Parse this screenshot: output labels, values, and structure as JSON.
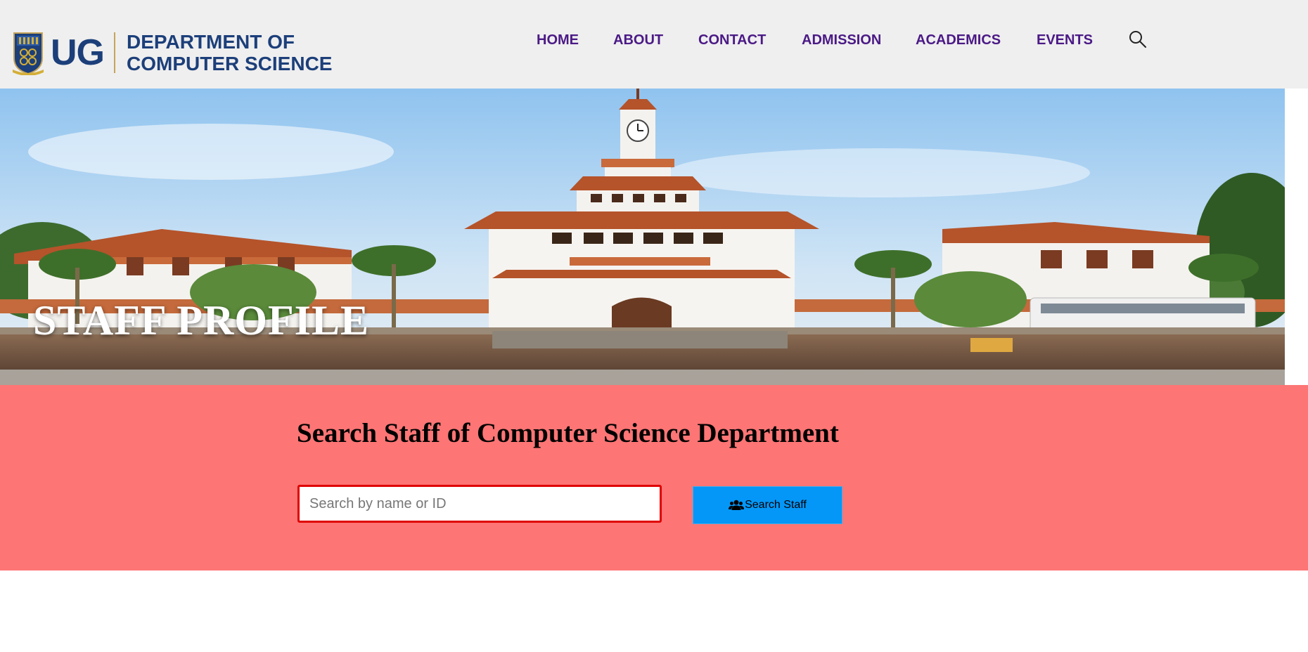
{
  "logo": {
    "short": "UG",
    "line1": "DEPARTMENT OF",
    "line2": "COMPUTER SCIENCE"
  },
  "nav": {
    "items": [
      {
        "label": "HOME"
      },
      {
        "label": "ABOUT"
      },
      {
        "label": "CONTACT"
      },
      {
        "label": "ADMISSION"
      },
      {
        "label": "ACADEMICS"
      },
      {
        "label": "EVENTS"
      }
    ],
    "search_icon": "search-icon"
  },
  "hero": {
    "title": "STAFF PROFILE",
    "image": "university-clock-tower-building"
  },
  "search": {
    "heading": "Search Staff of Computer Science Department",
    "placeholder": "Search by name or ID",
    "value": "",
    "button_label": "Search Staff",
    "button_icon": "users-icon"
  },
  "colors": {
    "header_bg": "#efefef",
    "brand_blue": "#1c3f7a",
    "nav_purple": "#4b1a86",
    "section_bg": "#fd7575",
    "button_blue": "#0497f7",
    "input_border": "#e00000"
  }
}
